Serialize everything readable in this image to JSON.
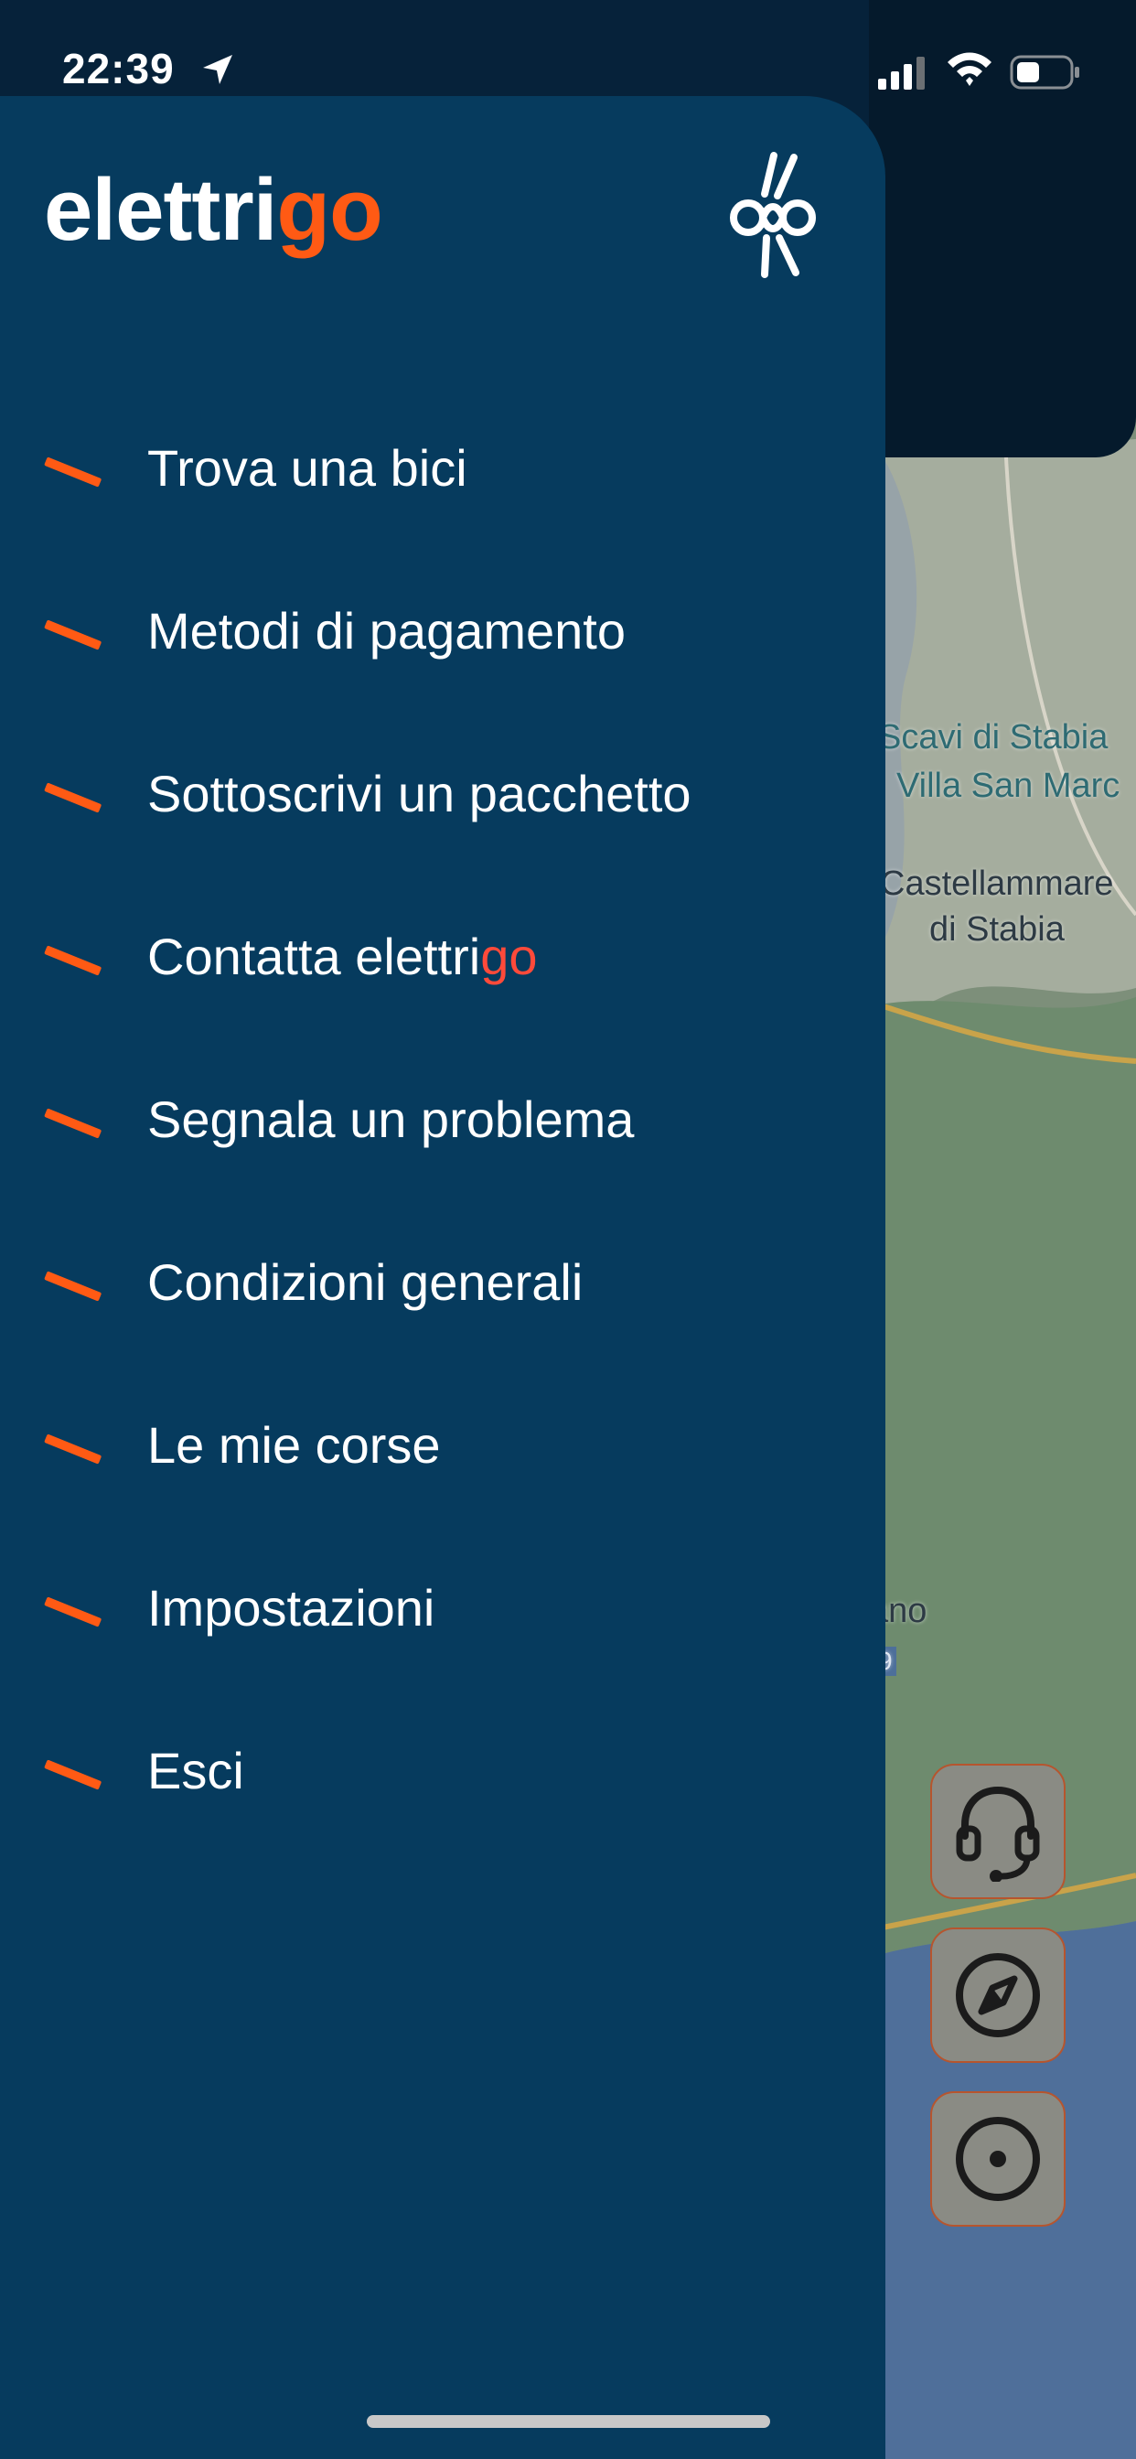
{
  "status_bar": {
    "time": "22:39",
    "icons": [
      "location-arrow-icon",
      "signal-icon",
      "wifi-icon",
      "battery-icon"
    ]
  },
  "drawer": {
    "logo": {
      "text_main": "elettri",
      "text_accent": "go"
    },
    "brand_icon": "bike-logo-icon",
    "menu": [
      {
        "label": "Trova una bici"
      },
      {
        "label": "Metodi di pagamento"
      },
      {
        "label": "Sottoscrivi un pacchetto"
      },
      {
        "label": "Contatta elettri",
        "label_accent": "go"
      },
      {
        "label": "Segnala un problema"
      },
      {
        "label": "Condizioni generali"
      },
      {
        "label": "Le mie corse"
      },
      {
        "label": "Impostazioni"
      },
      {
        "label": "Esci"
      }
    ]
  },
  "map": {
    "labels": [
      "Scavi di Stabia",
      "Villa San Marc",
      "Castellammare",
      "di Stabia",
      "ano",
      "9",
      "ano"
    ]
  },
  "map_buttons": [
    "headset-icon",
    "compass-icon",
    "locate-icon"
  ],
  "colors": {
    "drawer_bg": "#063b5e",
    "accent": "#ff5a14",
    "accent_text": "#ff4a3a",
    "header_dark": "#051a2c"
  }
}
